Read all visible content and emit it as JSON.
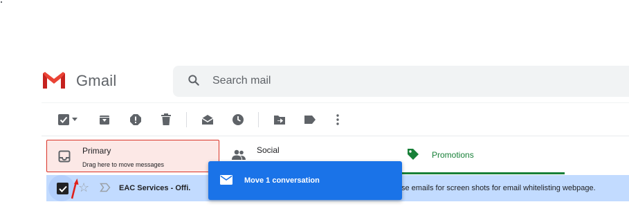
{
  "app": {
    "name": "Gmail"
  },
  "search": {
    "placeholder": "Search mail"
  },
  "toolbar": {
    "icons": [
      "select-all-checkbox-icon",
      "select-dropdown-icon",
      "archive-icon",
      "report-spam-icon",
      "delete-icon",
      "mark-as-read-icon",
      "snooze-icon",
      "move-to-icon",
      "labels-icon",
      "more-options-icon"
    ]
  },
  "tabs": {
    "primary": {
      "label": "Primary",
      "hint": "Drag here to move messages"
    },
    "social": {
      "label": "Social"
    },
    "promotions": {
      "label": "Promotions"
    }
  },
  "row": {
    "sender": "EAC Services - Offi.",
    "snippet": "se emails for screen shots for email whitelisting webpage.",
    "selected": true
  },
  "drag_toast": {
    "label": "Move 1 conversation"
  },
  "colors": {
    "accent": "#1a73e8",
    "primary_tab_bg": "#fce8e6",
    "primary_tab_border": "#d93025",
    "promotions_green": "#188038",
    "selected_row": "#c2dbff"
  }
}
